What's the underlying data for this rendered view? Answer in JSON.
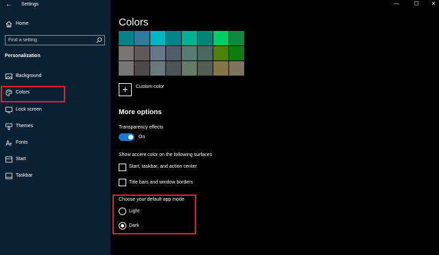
{
  "window": {
    "title": "Settings",
    "back_glyph": "←",
    "minimize_glyph": "—",
    "maximize_glyph": "☐",
    "close_glyph": "✕"
  },
  "sidebar": {
    "home_label": "Home",
    "search_placeholder": "Find a setting",
    "section_header": "Personalization",
    "items": [
      {
        "label": "Background",
        "icon": "picture-icon"
      },
      {
        "label": "Colors",
        "icon": "palette-icon",
        "selected": true
      },
      {
        "label": "Lock screen",
        "icon": "lock-screen-icon"
      },
      {
        "label": "Themes",
        "icon": "brush-icon"
      },
      {
        "label": "Fonts",
        "icon": "font-icon"
      },
      {
        "label": "Start",
        "icon": "start-icon"
      },
      {
        "label": "Taskbar",
        "icon": "taskbar-icon"
      }
    ]
  },
  "main": {
    "title": "Colors",
    "swatches": [
      [
        "#038387",
        "#2d7d9a",
        "#00b7c3",
        "#038387",
        "#00b294",
        "#018574",
        "#00cc6a",
        "#10893e"
      ],
      [
        "#7a7574",
        "#5d5a58",
        "#68768a",
        "#515c6b",
        "#567c73",
        "#486860",
        "#498205",
        "#107c10"
      ],
      [
        "#767676",
        "#4c4a48",
        "#69797e",
        "#4a5459",
        "#647c64",
        "#525e54",
        "#847545",
        "#7e735f"
      ]
    ],
    "custom_color_label": "Custom color",
    "more_options": "More options",
    "transparency": {
      "label": "Transparency effects",
      "state_label": "On",
      "on": true
    },
    "accent_surfaces": {
      "label": "Show accent color on the following surfaces",
      "options": [
        {
          "label": "Start, taskbar, and action center",
          "checked": false
        },
        {
          "label": "Title bars and window borders",
          "checked": false
        }
      ]
    },
    "app_mode": {
      "label": "Choose your default app mode",
      "options": [
        {
          "label": "Light",
          "selected": false
        },
        {
          "label": "Dark",
          "selected": true
        }
      ]
    }
  },
  "colors": {
    "sidebar_bg": "#0a2033",
    "accent": "#1679d6",
    "highlight": "#e0212c"
  }
}
